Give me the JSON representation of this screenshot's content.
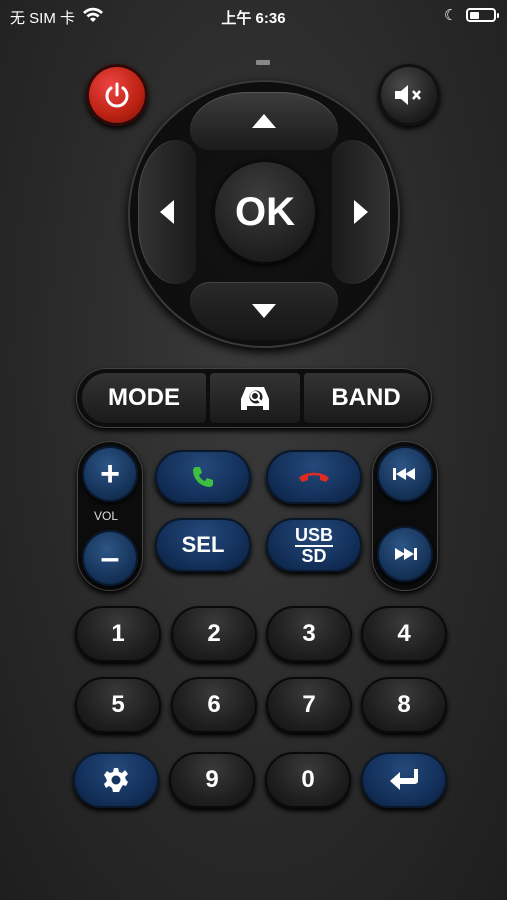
{
  "status_bar": {
    "carrier": "无 SIM 卡",
    "time": "上午 6:36"
  },
  "remote": {
    "ok_label": "OK",
    "mode_label": "MODE",
    "band_label": "BAND",
    "vol_label": "VOL",
    "vol_plus": "+",
    "vol_minus": "–",
    "sel_label": "SEL",
    "usb_top": "USB",
    "usb_bottom": "SD",
    "digits": [
      "1",
      "2",
      "3",
      "4",
      "5",
      "6",
      "7",
      "8",
      "9",
      "0"
    ]
  },
  "colors": {
    "power": "#c62a22",
    "accent_blue": "#1b3d6b",
    "call_green": "#3fbf3f",
    "hangup_red": "#e02a22"
  },
  "icons": [
    "wifi-icon",
    "moon-icon",
    "battery-icon",
    "power-icon",
    "mute-icon",
    "arrow-up-icon",
    "arrow-down-icon",
    "arrow-left-icon",
    "arrow-right-icon",
    "car-navigation-icon",
    "call-answer-icon",
    "call-hangup-icon",
    "previous-track-icon",
    "next-track-icon",
    "settings-gear-icon",
    "return-enter-icon"
  ]
}
